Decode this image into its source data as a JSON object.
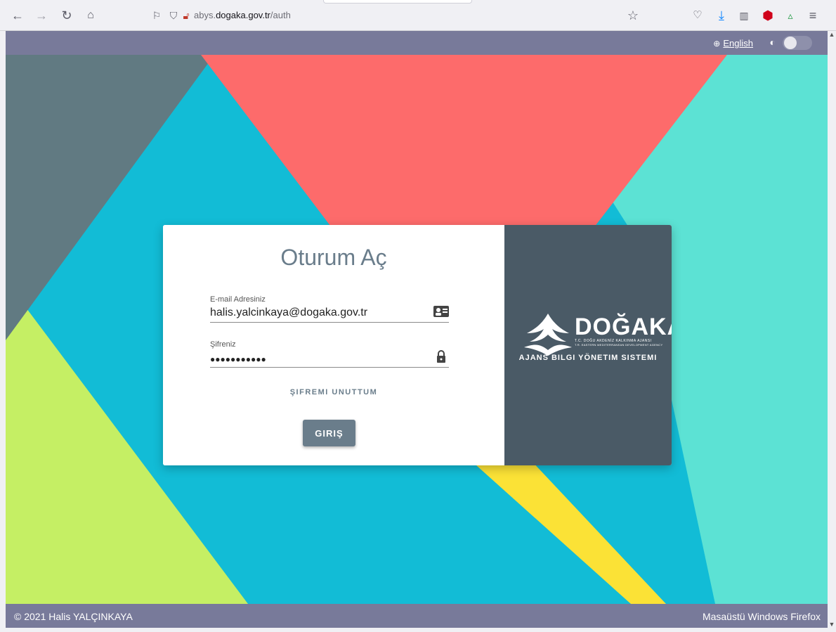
{
  "browser": {
    "url_prefix": "abys.",
    "url_domain": "dogaka.gov.tr",
    "url_path": "/auth",
    "icons": [
      "back-icon",
      "forward-icon",
      "reload-icon",
      "home-icon",
      "bookmark-page-icon",
      "shield-icon",
      "lock-warning-icon",
      "star-icon",
      "pocket-icon",
      "download-icon",
      "sidebar-icon",
      "ublock-icon",
      "extension-icon",
      "menu-icon"
    ]
  },
  "topbar": {
    "language_label": "English"
  },
  "login": {
    "title": "Oturum Aç",
    "email_label": "E-mail Adresiniz",
    "email_value": "halis.yalcinkaya@dogaka.gov.tr",
    "password_label": "Şifreniz",
    "password_value": "●●●●●●●●●●●",
    "forgot_label": "ŞIFREMI UNUTTUM",
    "submit_label": "GIRIŞ"
  },
  "brand": {
    "name": "DOĞAKA",
    "tagline_tr": "T.C. DOĞU AKDENİZ KALKINMA AJANSI",
    "tagline_en": "T.R. EASTERN MEDITERRANEAN DEVELOPMENT AGENCY",
    "subtitle": "AJANS BILGI YÖNETIM SISTEMI"
  },
  "footer": {
    "copyright": "© 2021 Halis YALÇINKAYA",
    "platform": "Masaüstü Windows Firefox"
  },
  "colors": {
    "topbar": "#787a9a",
    "brand_panel": "#4a5a66",
    "accent": "#6a7d8b",
    "bg_red": "#fd6b6b",
    "bg_cyan": "#12bcd6",
    "bg_teal": "#5ce2d4",
    "bg_lime": "#c5ef64",
    "bg_slate": "#617a82",
    "bg_yellow": "#fbe236"
  }
}
